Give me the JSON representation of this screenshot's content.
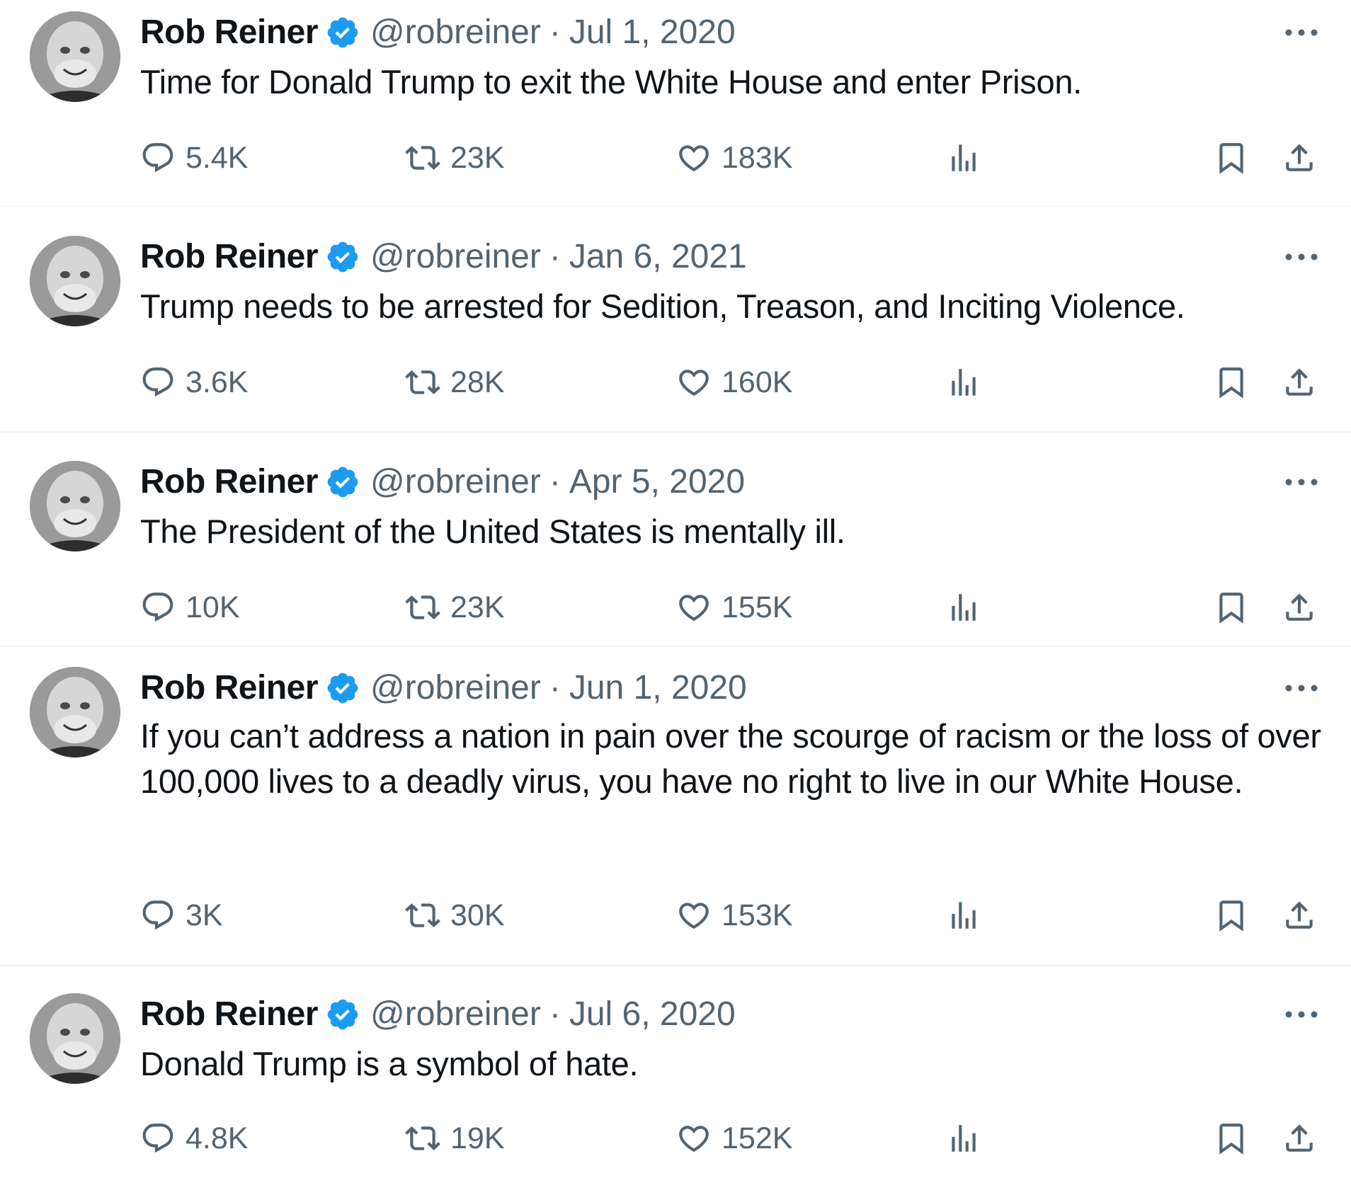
{
  "tweets": [
    {
      "name": "Rob Reiner",
      "handle": "@robreiner",
      "separator": "·",
      "date": "Jul 1, 2020",
      "text": "Time for Donald Trump to exit the White House and enter Prison.",
      "replies": "5.4K",
      "retweets": "23K",
      "likes": "183K"
    },
    {
      "name": "Rob Reiner",
      "handle": "@robreiner",
      "separator": "·",
      "date": "Jan 6, 2021",
      "text": "Trump needs to be arrested for Sedition, Treason, and Inciting Violence.",
      "replies": "3.6K",
      "retweets": "28K",
      "likes": "160K"
    },
    {
      "name": "Rob Reiner",
      "handle": "@robreiner",
      "separator": "·",
      "date": "Apr 5, 2020",
      "text": "The President of the United States is mentally ill.",
      "replies": "10K",
      "retweets": "23K",
      "likes": "155K"
    },
    {
      "name": "Rob Reiner",
      "handle": "@robreiner",
      "separator": "·",
      "date": "Jun 1, 2020",
      "text": "If you can’t address a nation in pain over the scourge of racism or the loss of over 100,000 lives to a deadly virus, you have no right to live in our White House.",
      "replies": "3K",
      "retweets": "30K",
      "likes": "153K"
    },
    {
      "name": "Rob Reiner",
      "handle": "@robreiner",
      "separator": "·",
      "date": "Jul 6, 2020",
      "text": "Donald Trump is a symbol of hate.",
      "replies": "4.8K",
      "retweets": "19K",
      "likes": "152K"
    }
  ],
  "icons": {
    "reply": "reply-icon",
    "retweet": "retweet-icon",
    "like": "heart-icon",
    "views": "views-icon",
    "bookmark": "bookmark-icon",
    "share": "share-icon",
    "verified": "verified-badge-icon",
    "more": "more-options-icon"
  },
  "colors": {
    "text": "#0f1419",
    "secondary": "#536471",
    "verified": "#1d9bf0",
    "divider": "#eff3f4"
  }
}
